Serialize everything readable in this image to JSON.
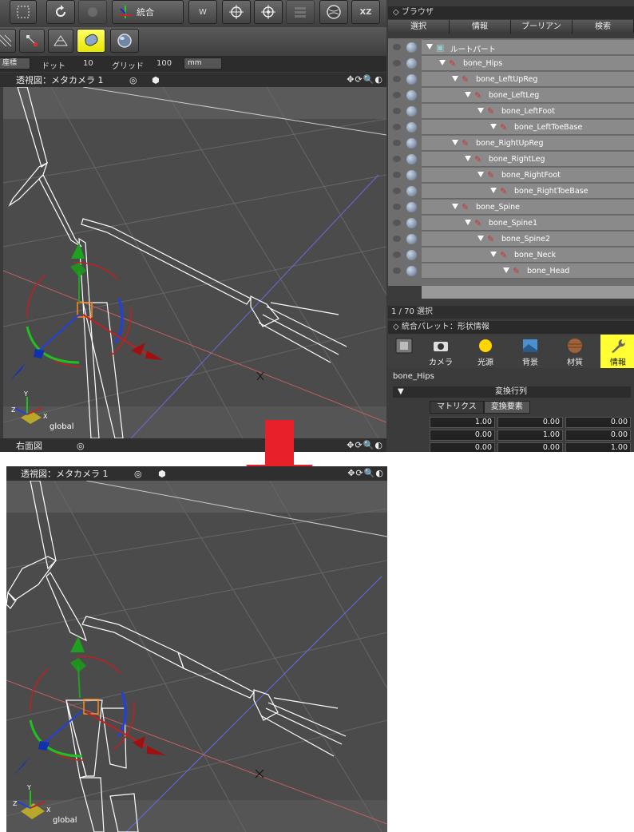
{
  "toolbar": {
    "merge_label": "統合",
    "xz_label": "XZ",
    "w_label": "W"
  },
  "statusbar": {
    "coord_label": "座標",
    "dot_label": "ドット",
    "dot_value": "10",
    "grid_label": "グリッド",
    "grid_value": "100",
    "unit": "mm"
  },
  "viewport_top": {
    "title": "透視図：メタカメラ 1",
    "axis_label": "global",
    "x_axis": "X",
    "y_axis": "Y",
    "z_axis": "Z"
  },
  "viewport_right": {
    "title": "右面図"
  },
  "browser": {
    "title": "ブラウザ",
    "tabs": [
      "選択",
      "情報",
      "ブーリアン",
      "検索"
    ],
    "items": [
      {
        "label": "ルートパート",
        "depth": 0
      },
      {
        "label": "bone_Hips",
        "depth": 1
      },
      {
        "label": "bone_LeftUpReg",
        "depth": 2
      },
      {
        "label": "bone_LeftLeg",
        "depth": 3
      },
      {
        "label": "bone_LeftFoot",
        "depth": 4
      },
      {
        "label": "bone_LeftToeBase",
        "depth": 5
      },
      {
        "label": "bone_RightUpReg",
        "depth": 2
      },
      {
        "label": "bone_RightLeg",
        "depth": 3
      },
      {
        "label": "bone_RightFoot",
        "depth": 4
      },
      {
        "label": "bone_RightToeBase",
        "depth": 5
      },
      {
        "label": "bone_Spine",
        "depth": 2
      },
      {
        "label": "bone_Spine1",
        "depth": 3
      },
      {
        "label": "bone_Spine2",
        "depth": 4
      },
      {
        "label": "bone_Neck",
        "depth": 5
      },
      {
        "label": "bone_Head",
        "depth": 6
      }
    ],
    "selection_count": "1 / 70 選択"
  },
  "palette": {
    "title": "統合パレット：形状情報",
    "tabs": [
      "カメラ",
      "光源",
      "背景",
      "材質",
      "情報"
    ],
    "active_tab": "情報",
    "shape_name": "bone_Hips",
    "section": "変換行列",
    "sub_tabs": [
      "マトリクス",
      "変換要素"
    ],
    "matrix": [
      [
        "1.00",
        "0.00",
        "0.00"
      ],
      [
        "0.00",
        "1.00",
        "0.00"
      ],
      [
        "0.00",
        "0.00",
        "1.00"
      ]
    ]
  },
  "viewport_bottom": {
    "title": "透視図：メタカメラ 1",
    "axis_label": "global",
    "x_axis": "X",
    "y_axis": "Y",
    "z_axis": "Z"
  },
  "colors": {
    "arrow": "#e8202a",
    "highlight": "#ffff33",
    "viewport_bg": "#4a4a4a",
    "bone_icon": "#cc3333"
  }
}
